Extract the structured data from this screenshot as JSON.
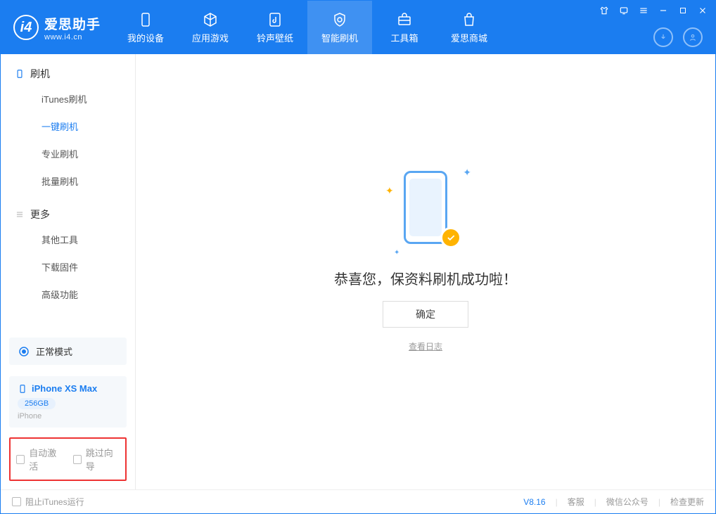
{
  "app": {
    "name_ch": "爱思助手",
    "url": "www.i4.cn"
  },
  "tabs": [
    {
      "label": "我的设备"
    },
    {
      "label": "应用游戏"
    },
    {
      "label": "铃声壁纸"
    },
    {
      "label": "智能刷机"
    },
    {
      "label": "工具箱"
    },
    {
      "label": "爱思商城"
    }
  ],
  "sidebar": {
    "section1": {
      "title": "刷机",
      "items": [
        "iTunes刷机",
        "一键刷机",
        "专业刷机",
        "批量刷机"
      ]
    },
    "section2": {
      "title": "更多",
      "items": [
        "其他工具",
        "下载固件",
        "高级功能"
      ]
    }
  },
  "mode": {
    "label": "正常模式"
  },
  "device": {
    "name": "iPhone XS Max",
    "storage": "256GB",
    "type": "iPhone"
  },
  "options": {
    "auto_activate": "自动激活",
    "skip_guide": "跳过向导"
  },
  "main": {
    "success_message": "恭喜您，保资料刷机成功啦！",
    "ok_button": "确定",
    "view_log": "查看日志"
  },
  "footer": {
    "block_itunes": "阻止iTunes运行",
    "version": "V8.16",
    "support": "客服",
    "wechat": "微信公众号",
    "check_update": "检查更新"
  }
}
